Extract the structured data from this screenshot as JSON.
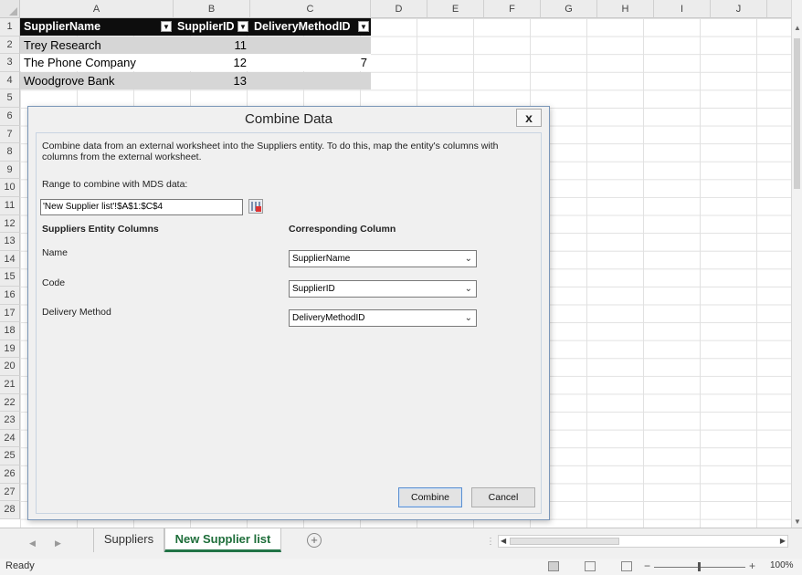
{
  "spreadsheet": {
    "columns": [
      "A",
      "B",
      "C",
      "D",
      "E",
      "F",
      "G",
      "H",
      "I",
      "J"
    ],
    "rows": [
      "1",
      "2",
      "3",
      "4",
      "5",
      "6",
      "7",
      "8",
      "9",
      "10",
      "11",
      "12",
      "13",
      "14",
      "15",
      "16",
      "17",
      "18",
      "19",
      "20",
      "21",
      "22",
      "23",
      "24",
      "25",
      "26",
      "27",
      "28"
    ],
    "table": {
      "headers": [
        "SupplierName",
        "SupplierID",
        "DeliveryMethodID"
      ],
      "rows": [
        {
          "name": "Trey Research",
          "id": "11",
          "method": ""
        },
        {
          "name": "The Phone Company",
          "id": "12",
          "method": "7"
        },
        {
          "name": "Woodgrove Bank",
          "id": "13",
          "method": ""
        }
      ]
    }
  },
  "dialog": {
    "title": "Combine Data",
    "close_label": "x",
    "description": "Combine data from an external worksheet into the Suppliers entity. To do this, map the entity's columns with columns from the external worksheet.",
    "range_label": "Range to combine with MDS data:",
    "range_value": "'New Supplier list'!$A$1:$C$4",
    "entity_columns_header": "Suppliers Entity Columns",
    "corresponding_header": "Corresponding Column",
    "mappings": [
      {
        "entity": "Name",
        "column": "SupplierName"
      },
      {
        "entity": "Code",
        "column": "SupplierID"
      },
      {
        "entity": "Delivery Method",
        "column": "DeliveryMethodID"
      }
    ],
    "combine_label": "Combine",
    "cancel_label": "Cancel"
  },
  "sheet_tabs": {
    "tabs": [
      "Suppliers",
      "New Supplier list"
    ],
    "active": "New Supplier list",
    "add_label": "+"
  },
  "status": {
    "ready": "Ready",
    "zoom": "100%"
  }
}
